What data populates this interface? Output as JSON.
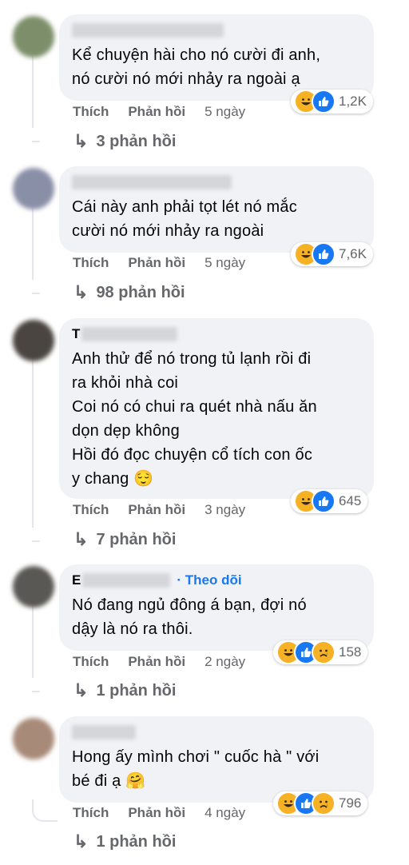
{
  "comments": [
    {
      "text": "Kể chuyện hài cho nó cười đi anh,\nnó cười nó mới nhảy ra ngoài ạ",
      "like_label": "Thích",
      "reply_label": "Phản hồi",
      "age": "5 ngày",
      "reactions": [
        "haha",
        "like"
      ],
      "reaction_count": "1,2K",
      "replies_label": "3 phản hồi"
    },
    {
      "text": "Cái này anh phải tọt lét nó mắc\ncười nó mới nhảy ra ngoài",
      "like_label": "Thích",
      "reply_label": "Phản hồi",
      "age": "5 ngày",
      "reactions": [
        "haha",
        "like"
      ],
      "reaction_count": "7,6K",
      "replies_label": "98 phản hồi"
    },
    {
      "author_initial": "T",
      "text": "Anh thử để nó trong tủ lạnh rồi đi\nra khỏi nhà coi\nCoi nó có chui ra quét nhà nấu ăn\ndọn dẹp không\nHồi đó đọc chuyện cổ tích con ốc\ny chang 😌",
      "like_label": "Thích",
      "reply_label": "Phản hồi",
      "age": "3 ngày",
      "reactions": [
        "haha",
        "like"
      ],
      "reaction_count": "645",
      "replies_label": "7 phản hồi"
    },
    {
      "author_initial": "E",
      "follow_label": "Theo dõi",
      "text": "Nó đang ngủ đông á bạn, đợi nó\ndậy là nó ra thôi.",
      "like_label": "Thích",
      "reply_label": "Phản hồi",
      "age": "2 ngày",
      "reactions": [
        "haha",
        "like",
        "sad"
      ],
      "reaction_count": "158",
      "replies_label": "1 phản hồi"
    },
    {
      "text": "Hong ấy mình chơi \" cuốc hà \" với\nbé đi ạ 🤗",
      "like_label": "Thích",
      "reply_label": "Phản hồi",
      "age": "4 ngày",
      "reactions": [
        "haha",
        "like",
        "sad"
      ],
      "reaction_count": "796",
      "replies_label": "1 phản hồi"
    }
  ],
  "reply_arrow": "↳",
  "colors": {
    "bubble": "#f0f2f5",
    "meta": "#65676b",
    "link": "#1877f2",
    "like": "#1877f2",
    "haha": "#f7b125"
  }
}
